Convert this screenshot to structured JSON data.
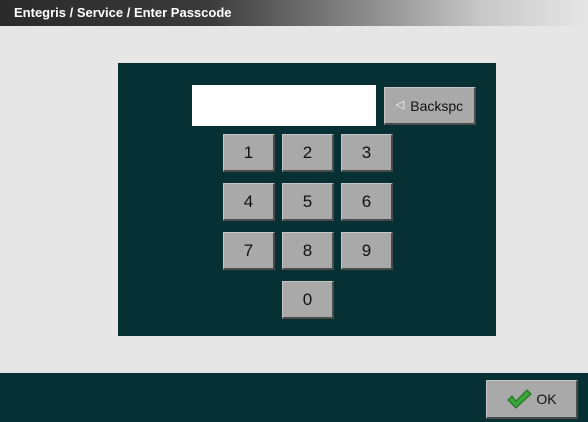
{
  "title_bar": {
    "breadcrumb": "Entegris / Service / Enter Passcode"
  },
  "passcode": {
    "value": ""
  },
  "keypad": {
    "backspace_label": "Backspc",
    "backspace_icon": "triangle-left-icon",
    "keys": [
      "1",
      "2",
      "3",
      "4",
      "5",
      "6",
      "7",
      "8",
      "9",
      "0"
    ]
  },
  "footer": {
    "ok_label": "OK",
    "ok_icon": "checkmark-icon"
  },
  "colors": {
    "panel": "#063033",
    "background": "#e6e6e6",
    "key": "#a9a9a9",
    "check": "#3aa43a"
  }
}
